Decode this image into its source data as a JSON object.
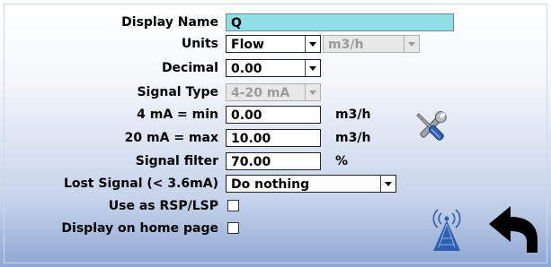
{
  "fields": {
    "display_name": {
      "label": "Display Name",
      "value": "Q"
    },
    "units": {
      "label": "Units",
      "category": "Flow",
      "unit": "m3/h"
    },
    "decimal": {
      "label": "Decimal",
      "value": "0.00"
    },
    "signal_type": {
      "label": "Signal Type",
      "value": "4-20 mA"
    },
    "min": {
      "label": "4 mA = min",
      "value": "0.00",
      "unit": "m3/h"
    },
    "max": {
      "label": "20 mA = max",
      "value": "10.00",
      "unit": "m3/h"
    },
    "filter": {
      "label": "Signal filter",
      "value": "70.00",
      "unit": "%"
    },
    "lost_signal": {
      "label": "Lost Signal (< 3.6mA)",
      "value": "Do nothing"
    },
    "use_rsp": {
      "label": "Use as RSP/LSP",
      "checked": false
    },
    "home_page": {
      "label": "Display on home page",
      "checked": false
    }
  },
  "icons": {
    "tools": "tools-icon",
    "signal_tower": "signal-tower-icon",
    "back": "back-arrow-icon"
  },
  "colors": {
    "name_field": "#8fe0e4",
    "gradient_bottom": "#8ea6d2",
    "icon_blue": "#2f5fb0"
  }
}
